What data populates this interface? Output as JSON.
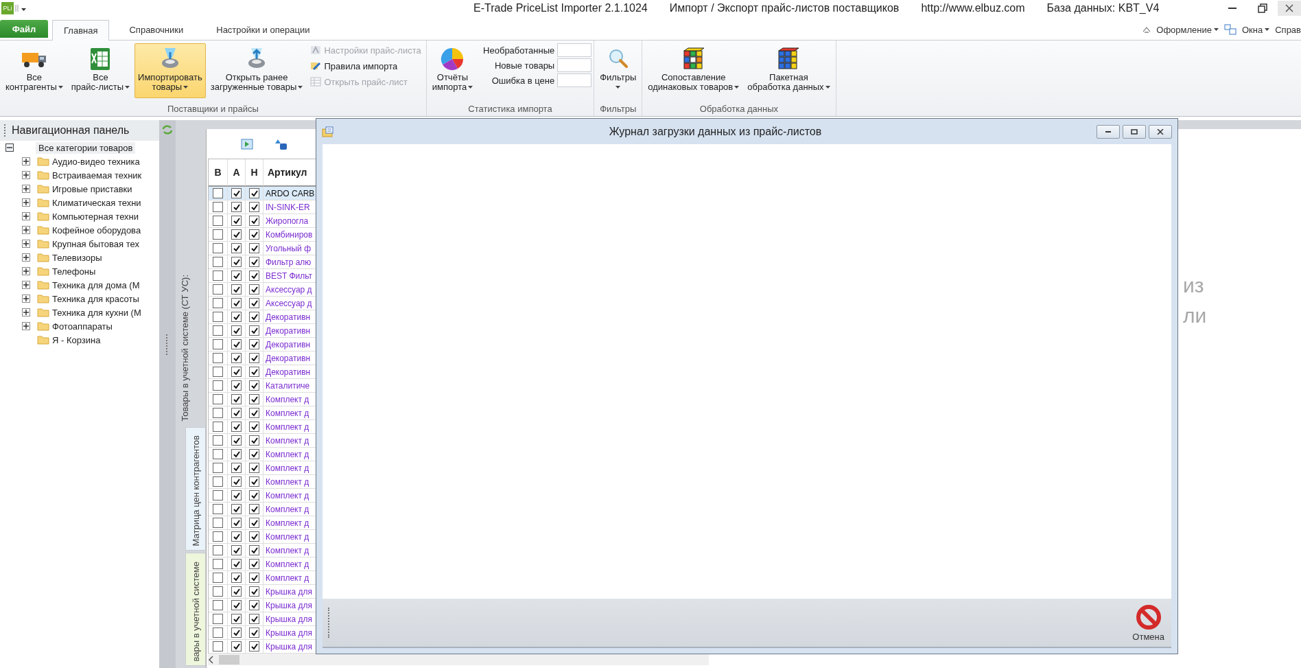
{
  "title_bar": {
    "logo": "PLi",
    "segments": [
      "E-Trade PriceList Importer 2.1.1024",
      "Импорт / Экспорт прайс-листов поставщиков",
      "http://www.elbuz.com",
      "База данных: KBT_V4"
    ]
  },
  "menu_tabs": [
    {
      "label": "Файл",
      "kind": "file",
      "selected": false
    },
    {
      "label": "Главная",
      "kind": "tab",
      "selected": true
    },
    {
      "label": "Справочники",
      "kind": "tab",
      "selected": false
    },
    {
      "label": "Настройки и операции",
      "kind": "tab",
      "selected": false
    }
  ],
  "right_menu": [
    {
      "label": "Оформление",
      "dropdown": true
    },
    {
      "label": "Окна",
      "dropdown": true
    },
    {
      "label": "Справ",
      "dropdown": false
    }
  ],
  "ribbon": {
    "groups": [
      {
        "label": "Поставщики и прайсы",
        "items": [
          {
            "kind": "large",
            "lines": [
              "Все",
              "контрагенты"
            ],
            "dropdown": true,
            "selected": false
          },
          {
            "kind": "large",
            "lines": [
              "Все",
              "прайс-листы"
            ],
            "dropdown": true,
            "selected": false
          },
          {
            "kind": "large",
            "lines": [
              "Импортировать",
              "товары"
            ],
            "dropdown": true,
            "selected": true
          },
          {
            "kind": "large",
            "lines": [
              "Открыть ранее",
              "загруженные товары"
            ],
            "dropdown": true,
            "selected": false
          },
          {
            "kind": "stack",
            "items": [
              {
                "label": "Настройки прайс-листа",
                "disabled": true
              },
              {
                "label": "Правила импорта",
                "disabled": false
              },
              {
                "label": "Открыть прайс-лист",
                "disabled": true
              }
            ]
          }
        ]
      },
      {
        "label": "Статистика импорта",
        "items": [
          {
            "kind": "large",
            "lines": [
              "Отчёты",
              "импорта"
            ],
            "dropdown": true,
            "selected": false
          },
          {
            "kind": "fields",
            "items": [
              {
                "label": "Необработанные"
              },
              {
                "label": "Новые товары"
              },
              {
                "label": "Ошибка в цене"
              }
            ]
          }
        ]
      },
      {
        "label": "Фильтры",
        "items": [
          {
            "kind": "large",
            "lines": [
              "Фильтры"
            ],
            "dropdown": true,
            "selected": false
          }
        ]
      },
      {
        "label": "Обработка данных",
        "items": [
          {
            "kind": "large",
            "lines": [
              "Сопоставление",
              "одинаковых товаров"
            ],
            "dropdown": true,
            "selected": false
          },
          {
            "kind": "large",
            "lines": [
              "Пакетная",
              "обработка данных"
            ],
            "dropdown": true,
            "selected": false
          }
        ]
      }
    ]
  },
  "nav": {
    "title": "Навигационная панель",
    "tree": [
      {
        "label": "Все категории товаров",
        "expandable": true,
        "expanded": true,
        "selected": true,
        "children": [
          {
            "label": "Аудио-видео техника",
            "expandable": true,
            "selected": false
          },
          {
            "label": "Встраиваемая техник",
            "expandable": true,
            "selected": false
          },
          {
            "label": "Игровые приставки",
            "expandable": true,
            "selected": false
          },
          {
            "label": "Климатическая техни",
            "expandable": true,
            "selected": false
          },
          {
            "label": "Компьютерная техни",
            "expandable": true,
            "selected": false
          },
          {
            "label": "Кофейное оборудова",
            "expandable": true,
            "selected": false
          },
          {
            "label": "Крупная бытовая тех",
            "expandable": true,
            "selected": false
          },
          {
            "label": "Телевизоры",
            "expandable": true,
            "selected": false
          },
          {
            "label": "Телефоны",
            "expandable": true,
            "selected": false
          },
          {
            "label": "Техника для дома (М",
            "expandable": true,
            "selected": false
          },
          {
            "label": "Техника для красоты",
            "expandable": true,
            "selected": false
          },
          {
            "label": "Техника для кухни (М",
            "expandable": true,
            "selected": false
          },
          {
            "label": "Фотоаппараты",
            "expandable": true,
            "selected": false
          },
          {
            "label": "Я - Корзина",
            "expandable": false,
            "selected": false
          }
        ]
      }
    ]
  },
  "side_caption": "Товары в учетной системе (СТ УС):",
  "side_tabs": [
    {
      "label": "Матрица цен контрагентов",
      "selected": false
    },
    {
      "label": "вары в учетной системе",
      "selected": true
    }
  ],
  "table": {
    "columns": [
      "В",
      "А",
      "Н",
      "Артикул"
    ],
    "rows": [
      {
        "b": false,
        "a": true,
        "n": true,
        "article": "ARDO CARB",
        "selected": true
      },
      {
        "b": false,
        "a": true,
        "n": true,
        "article": "IN-SINK-ER",
        "selected": false
      },
      {
        "b": false,
        "a": true,
        "n": true,
        "article": "Жиропогла",
        "selected": false
      },
      {
        "b": false,
        "a": true,
        "n": true,
        "article": "Комбиниров",
        "selected": false
      },
      {
        "b": false,
        "a": true,
        "n": true,
        "article": "Угольный ф",
        "selected": false
      },
      {
        "b": false,
        "a": true,
        "n": true,
        "article": "Фильтр алю",
        "selected": false
      },
      {
        "b": false,
        "a": true,
        "n": true,
        "article": "BEST Фильт",
        "selected": false
      },
      {
        "b": false,
        "a": true,
        "n": true,
        "article": "Аксессуар д",
        "selected": false
      },
      {
        "b": false,
        "a": true,
        "n": true,
        "article": "Аксессуар д",
        "selected": false
      },
      {
        "b": false,
        "a": true,
        "n": true,
        "article": "Декоративн",
        "selected": false
      },
      {
        "b": false,
        "a": true,
        "n": true,
        "article": "Декоративн",
        "selected": false
      },
      {
        "b": false,
        "a": true,
        "n": true,
        "article": "Декоративн",
        "selected": false
      },
      {
        "b": false,
        "a": true,
        "n": true,
        "article": "Декоративн",
        "selected": false
      },
      {
        "b": false,
        "a": true,
        "n": true,
        "article": "Декоративн",
        "selected": false
      },
      {
        "b": false,
        "a": true,
        "n": true,
        "article": "Каталитиче",
        "selected": false
      },
      {
        "b": false,
        "a": true,
        "n": true,
        "article": "Комплект д",
        "selected": false
      },
      {
        "b": false,
        "a": true,
        "n": true,
        "article": "Комплект д",
        "selected": false
      },
      {
        "b": false,
        "a": true,
        "n": true,
        "article": "Комплект д",
        "selected": false
      },
      {
        "b": false,
        "a": true,
        "n": true,
        "article": "Комплект д",
        "selected": false
      },
      {
        "b": false,
        "a": true,
        "n": true,
        "article": "Комплект д",
        "selected": false
      },
      {
        "b": false,
        "a": true,
        "n": true,
        "article": "Комплект д",
        "selected": false
      },
      {
        "b": false,
        "a": true,
        "n": true,
        "article": "Комплект д",
        "selected": false
      },
      {
        "b": false,
        "a": true,
        "n": true,
        "article": "Комплект д",
        "selected": false
      },
      {
        "b": false,
        "a": true,
        "n": true,
        "article": "Комплект д",
        "selected": false
      },
      {
        "b": false,
        "a": true,
        "n": true,
        "article": "Комплект д",
        "selected": false
      },
      {
        "b": false,
        "a": true,
        "n": true,
        "article": "Комплект д",
        "selected": false
      },
      {
        "b": false,
        "a": true,
        "n": true,
        "article": "Комплект д",
        "selected": false
      },
      {
        "b": false,
        "a": true,
        "n": true,
        "article": "Комплект д",
        "selected": false
      },
      {
        "b": false,
        "a": true,
        "n": true,
        "article": "Комплект д",
        "selected": false
      },
      {
        "b": false,
        "a": true,
        "n": true,
        "article": "Крышка для",
        "selected": false
      },
      {
        "b": false,
        "a": true,
        "n": true,
        "article": "Крышка для",
        "selected": false
      },
      {
        "b": false,
        "a": true,
        "n": true,
        "article": "Крышка для",
        "selected": false
      },
      {
        "b": false,
        "a": true,
        "n": true,
        "article": "Крышка для",
        "selected": false
      },
      {
        "b": false,
        "a": true,
        "n": true,
        "article": "Крышка для",
        "selected": false
      }
    ]
  },
  "background_text": [
    "из",
    "ли"
  ],
  "dialog": {
    "title": "Журнал загрузки данных из прайс-листов",
    "cancel": "Отмена"
  }
}
